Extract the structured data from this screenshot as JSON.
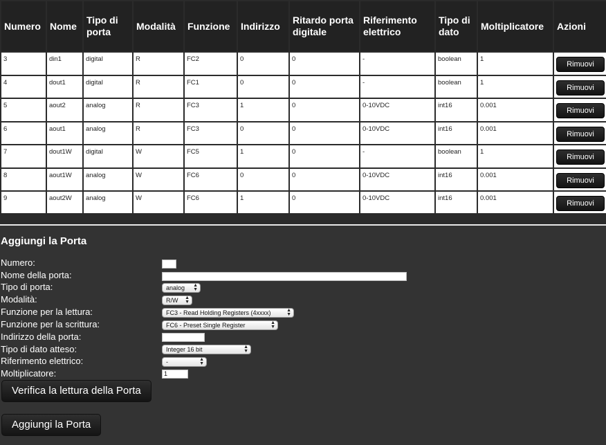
{
  "table": {
    "headers": [
      "Numero",
      "Nome",
      "Tipo di porta",
      "Modalità",
      "Funzione",
      "Indirizzo",
      "Ritardo porta digitale",
      "Riferimento elettrico",
      "Tipo di dato",
      "Moltiplicatore",
      "Azioni"
    ],
    "rows": [
      [
        "3",
        "din1",
        "digital",
        "R",
        "FC2",
        "0",
        "0",
        "-",
        "boolean",
        "1"
      ],
      [
        "4",
        "dout1",
        "digital",
        "R",
        "FC1",
        "0",
        "0",
        "-",
        "boolean",
        "1"
      ],
      [
        "5",
        "aout2",
        "analog",
        "R",
        "FC3",
        "1",
        "0",
        "0-10VDC",
        "int16",
        "0.001"
      ],
      [
        "6",
        "aout1",
        "analog",
        "R",
        "FC3",
        "0",
        "0",
        "0-10VDC",
        "int16",
        "0.001"
      ],
      [
        "7",
        "dout1W",
        "digital",
        "W",
        "FC5",
        "1",
        "0",
        "-",
        "boolean",
        "1"
      ],
      [
        "8",
        "aout1W",
        "analog",
        "W",
        "FC6",
        "0",
        "0",
        "0-10VDC",
        "int16",
        "0.001"
      ],
      [
        "9",
        "aout2W",
        "analog",
        "W",
        "FC6",
        "1",
        "0",
        "0-10VDC",
        "int16",
        "0.001"
      ]
    ],
    "remove_label": "Rimuovi"
  },
  "form": {
    "title": "Aggiungi la Porta",
    "labels": {
      "numero": "Numero:",
      "nome": "Nome della porta:",
      "tipo": "Tipo di porta:",
      "modalita": "Modalità:",
      "funz_lettura": "Funzione per la lettura:",
      "funz_scrittura": "Funzione per la scrittura:",
      "indirizzo": "Indirizzo della porta:",
      "tipo_dato": "Tipo di dato atteso:",
      "riferimento": "Riferimento elettrico:",
      "moltiplicatore": "Moltiplicatore:"
    },
    "values": {
      "numero": "",
      "nome": "",
      "tipo": "analog",
      "modalita": "R/W",
      "funz_lettura": "FC3 - Read Holding Registers (4xxxx)",
      "funz_scrittura": "FC6 - Preset Single Register",
      "indirizzo": "",
      "tipo_dato": "Integer 16 bit",
      "riferimento": "-",
      "moltiplicatore": "1"
    },
    "verify_button": "Verifica la lettura della Porta",
    "add_button": "Aggiungi la Porta"
  }
}
